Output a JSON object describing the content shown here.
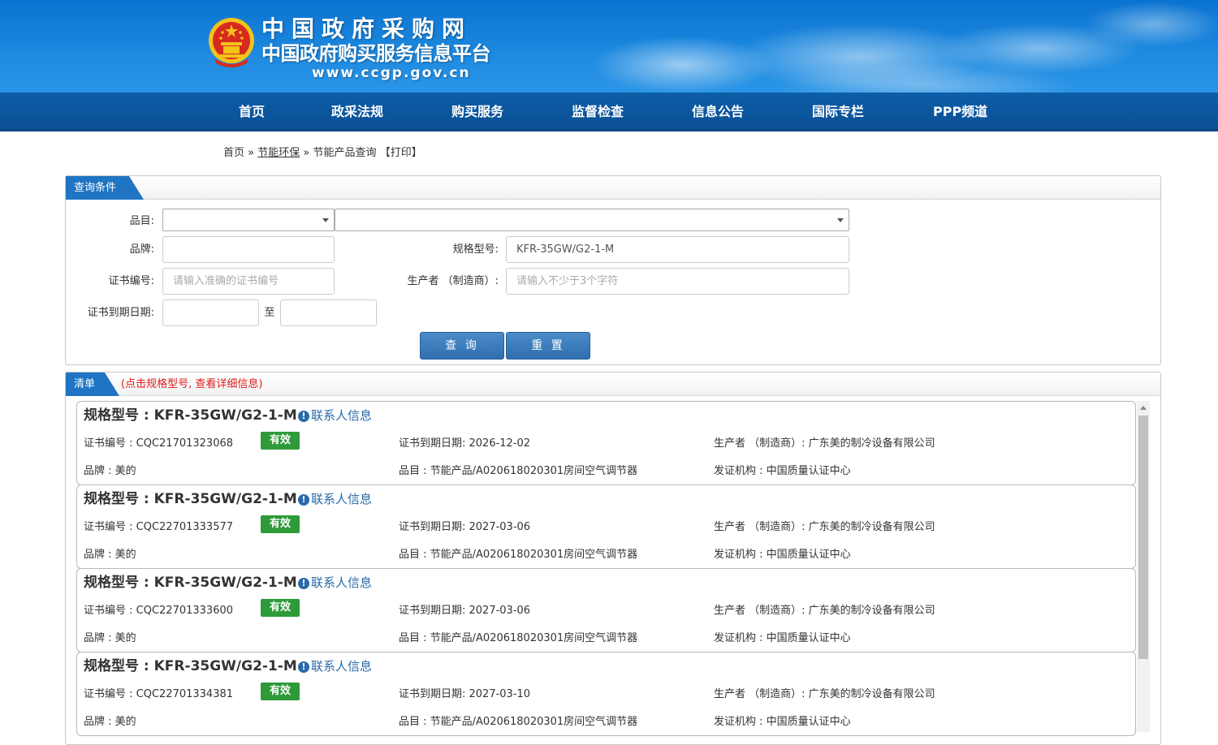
{
  "header": {
    "title": "中国政府采购网",
    "subtitle": "中国政府购买服务信息平台",
    "url": "www.ccgp.gov.cn",
    "emblem_icon": "national-emblem-icon"
  },
  "nav": {
    "items": [
      "首页",
      "政采法规",
      "购买服务",
      "监督检查",
      "信息公告",
      "国际专栏",
      "PPP频道"
    ]
  },
  "breadcrumb": {
    "home": "首页",
    "sep1": "»",
    "section": "节能环保",
    "sep2": "»",
    "current": "节能产品查询",
    "print": "【打印】"
  },
  "query": {
    "tab": "查询条件",
    "category_label": "品目:",
    "brand_label": "品牌:",
    "model_label": "规格型号:",
    "model_value": "KFR-35GW/G2-1-M",
    "cert_no_label": "证书编号:",
    "cert_no_placeholder": "请输入准确的证书编号",
    "maker_label": "生产者 （制造商）:",
    "maker_placeholder": "请输入不少于3个字符",
    "expiry_label": "证书到期日期:",
    "to_label": "至",
    "search_btn": "查 询",
    "reset_btn": "重 置"
  },
  "list": {
    "tab": "清单",
    "hint": "(点击规格型号, 查看详细信息)",
    "contact_text": "联系人信息",
    "items": [
      {
        "title": "规格型号 : KFR-35GW/G2-1-M",
        "cert": "证书编号 : CQC21701323068",
        "status": "有效",
        "expiry": "证书到期日期: 2026-12-02",
        "maker": "生产者 （制造商）: 广东美的制冷设备有限公司",
        "brand": "品牌 : 美的",
        "category": "品目 : 节能产品/A020618020301房间空气调节器",
        "issuer": "发证机构 : 中国质量认证中心"
      },
      {
        "title": "规格型号 : KFR-35GW/G2-1-M",
        "cert": "证书编号 : CQC22701333577",
        "status": "有效",
        "expiry": "证书到期日期: 2027-03-06",
        "maker": "生产者 （制造商）: 广东美的制冷设备有限公司",
        "brand": "品牌 : 美的",
        "category": "品目 : 节能产品/A020618020301房间空气调节器",
        "issuer": "发证机构 : 中国质量认证中心"
      },
      {
        "title": "规格型号 : KFR-35GW/G2-1-M",
        "cert": "证书编号 : CQC22701333600",
        "status": "有效",
        "expiry": "证书到期日期: 2027-03-06",
        "maker": "生产者 （制造商）: 广东美的制冷设备有限公司",
        "brand": "品牌 : 美的",
        "category": "品目 : 节能产品/A020618020301房间空气调节器",
        "issuer": "发证机构 : 中国质量认证中心"
      },
      {
        "title": "规格型号 : KFR-35GW/G2-1-M",
        "cert": "证书编号 : CQC22701334381",
        "status": "有效",
        "expiry": "证书到期日期: 2027-03-10",
        "maker": "生产者 （制造商）: 广东美的制冷设备有限公司",
        "brand": "品牌 : 美的",
        "category": "品目 : 节能产品/A020618020301房间空气调节器",
        "issuer": "发证机构 : 中国质量认证中心"
      }
    ]
  },
  "colors": {
    "banner": "#1e8ae0",
    "nav": "#0a4f94",
    "tab": "#1f75c3",
    "valid_badge": "#2e9a3a",
    "hint": "#e01b1b",
    "link": "#2a6aaa"
  }
}
